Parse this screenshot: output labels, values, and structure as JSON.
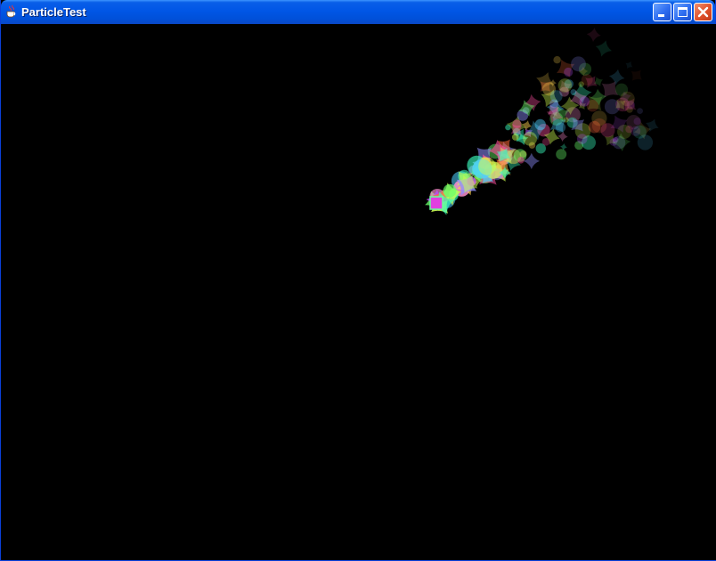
{
  "window": {
    "title": "ParticleTest",
    "app_icon": "java-cup-icon",
    "controls": {
      "minimize_icon": "minimize-icon",
      "maximize_icon": "maximize-icon",
      "close_icon": "close-icon"
    }
  },
  "colors": {
    "titlebar": "#0056e6",
    "canvas_background": "#000000",
    "close_button": "#e0502a"
  }
}
